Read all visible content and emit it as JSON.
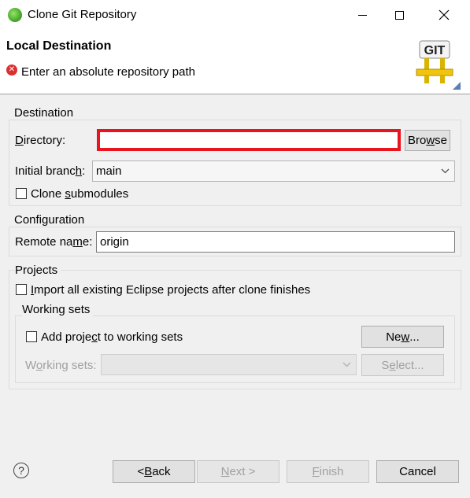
{
  "window": {
    "title": "Clone Git Repository"
  },
  "header": {
    "title": "Local Destination",
    "message": "Enter an absolute repository path",
    "logo_text": "GIT"
  },
  "destination": {
    "group_label": "Destination",
    "directory_label_pre": "",
    "directory_label_key": "D",
    "directory_label_post": "irectory:",
    "directory_value": "",
    "browse_pre": "Bro",
    "browse_key": "w",
    "browse_post": "se",
    "branch_label_pre": "Initial branc",
    "branch_label_key": "h",
    "branch_label_post": ":",
    "branch_value": "main",
    "submodules_pre": "Clone ",
    "submodules_key": "s",
    "submodules_post": "ubmodules",
    "submodules_checked": false
  },
  "configuration": {
    "group_label": "Configuration",
    "remote_label_pre": "Remote na",
    "remote_label_key": "m",
    "remote_label_post": "e:",
    "remote_value": "origin"
  },
  "projects": {
    "group_label": "Projects",
    "import_key": "I",
    "import_post": "mport all existing Eclipse projects after clone finishes",
    "import_checked": false,
    "working_sets": {
      "group_label": "Working sets",
      "add_pre": "Add proje",
      "add_key": "c",
      "add_post": "t to working sets",
      "add_checked": false,
      "new_pre": "Ne",
      "new_key": "w",
      "new_post": "...",
      "sets_label_pre": "W",
      "sets_label_key": "o",
      "sets_label_post": "rking sets:",
      "sets_value": "",
      "select_pre": "S",
      "select_key": "e",
      "select_post": "lect..."
    }
  },
  "footer": {
    "help_glyph": "?",
    "back_pre": "< ",
    "back_key": "B",
    "back_post": "ack",
    "next_pre": "",
    "next_key": "N",
    "next_post": "ext >",
    "finish_pre": "",
    "finish_key": "F",
    "finish_post": "inish",
    "cancel": "Cancel"
  },
  "colors": {
    "error_highlight": "#e8141e",
    "error_icon": "#d9312f",
    "disabled_text": "#a0a0a0"
  }
}
